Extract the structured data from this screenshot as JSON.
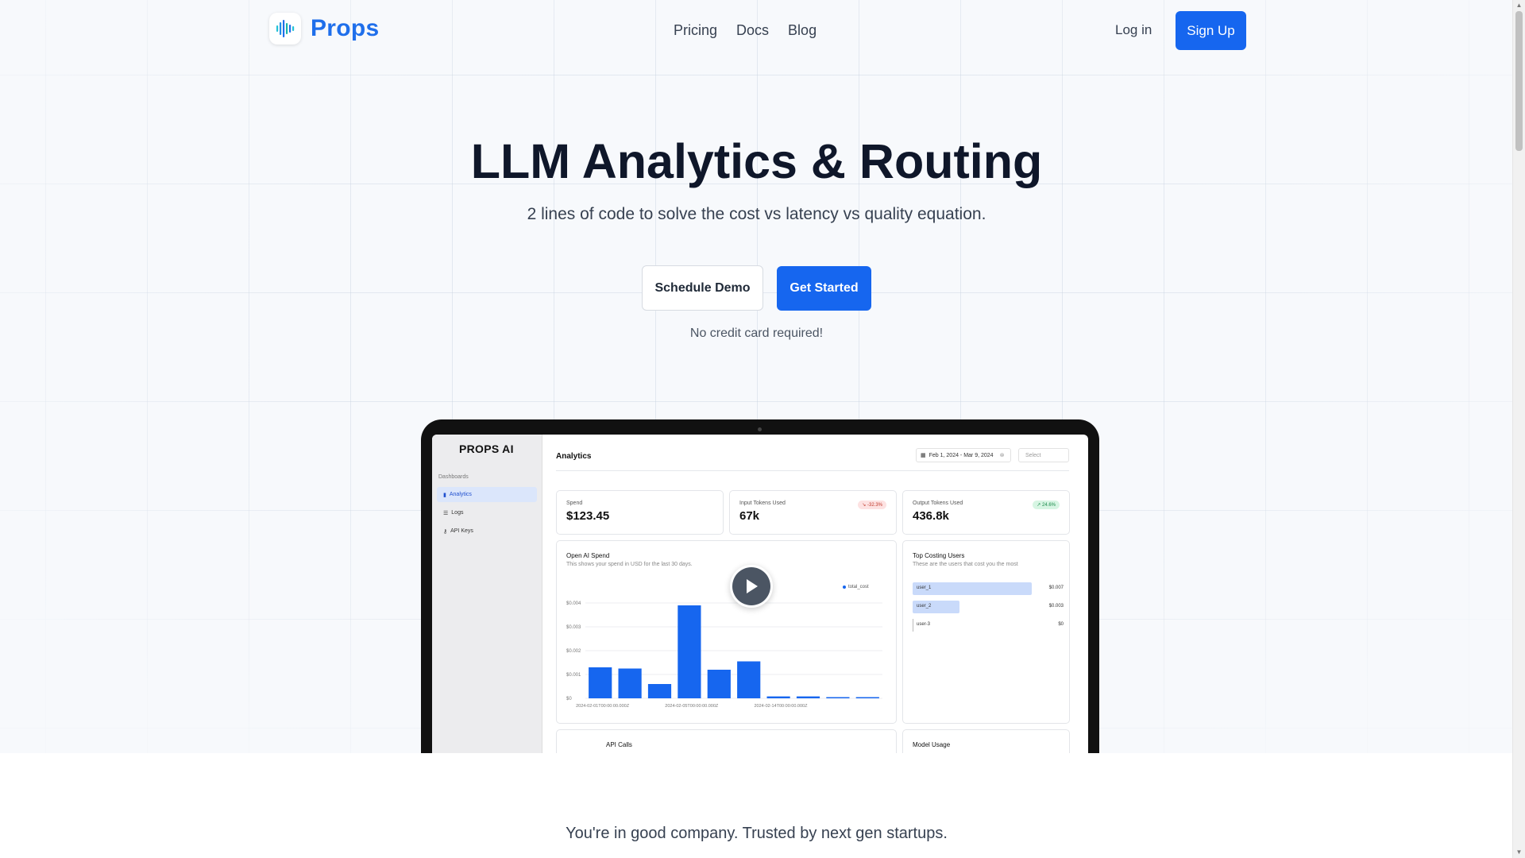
{
  "nav": {
    "brand": "Props",
    "links": [
      "Pricing",
      "Docs",
      "Blog"
    ],
    "login": "Log in",
    "signup": "Sign Up"
  },
  "hero": {
    "title": "LLM Analytics & Routing",
    "subtitle": "2 lines of code to solve the cost vs latency vs quality equation.",
    "demo_button": "Schedule Demo",
    "start_button": "Get Started",
    "note": "No credit card required!"
  },
  "dashboard": {
    "brand": "PROPS AI",
    "section": "Dashboards",
    "menu": [
      "Analytics",
      "Logs",
      "API Keys"
    ],
    "title": "Analytics",
    "date_range": "Feb 1, 2024 - Mar 9, 2024",
    "select_placeholder": "Select",
    "kpis": [
      {
        "label": "Spend",
        "value": "$123.45",
        "badge": ""
      },
      {
        "label": "Input Tokens Used",
        "value": "67k",
        "badge": "-32.3%"
      },
      {
        "label": "Output Tokens Used",
        "value": "436.8k",
        "badge": "24.6%"
      }
    ],
    "spend_card": {
      "title": "Open AI Spend",
      "subtitle": "This shows your spend in USD for the last 30 days.",
      "legend": "total_cost"
    },
    "top_users": {
      "title": "Top Costing Users",
      "subtitle": "These are the users that cost you the most",
      "users": [
        {
          "name": "user_1",
          "value": "$0.007",
          "share": 1.0
        },
        {
          "name": "user_2",
          "value": "$0.003",
          "share": 0.39
        },
        {
          "name": "user-3",
          "value": "$0",
          "share": 0
        }
      ]
    },
    "api_calls_title": "API Calls",
    "model_usage_title": "Model Usage"
  },
  "chart_data": {
    "type": "bar",
    "title": "Open AI Spend",
    "categories": [
      "2024-02-01T00:00:00.000Z",
      "",
      "",
      "2024-02-05T00:00:00.000Z",
      "",
      "",
      "2024-02-14T00:00:00.000Z",
      "",
      "",
      ""
    ],
    "values": [
      0.0013,
      0.00125,
      0.0006,
      0.0039,
      0.0012,
      0.00155,
      8e-05,
      8e-05,
      5e-05,
      0
    ],
    "series": [
      {
        "name": "total_cost",
        "values": [
          0.0013,
          0.00125,
          0.0006,
          0.0039,
          0.0012,
          0.00155,
          8e-05,
          8e-05,
          5e-05,
          0
        ]
      }
    ],
    "yticks": [
      "$0",
      "$0.001",
      "$0.002",
      "$0.003",
      "$0.004"
    ],
    "ylim": [
      0,
      0.004
    ],
    "grid": true,
    "legend": "top-right",
    "color": "#1666ef"
  },
  "footer": {
    "trusted": "You're in good company. Trusted by next gen startups."
  },
  "colors": {
    "primary": "#1666ef",
    "heading": "#0f172a"
  }
}
